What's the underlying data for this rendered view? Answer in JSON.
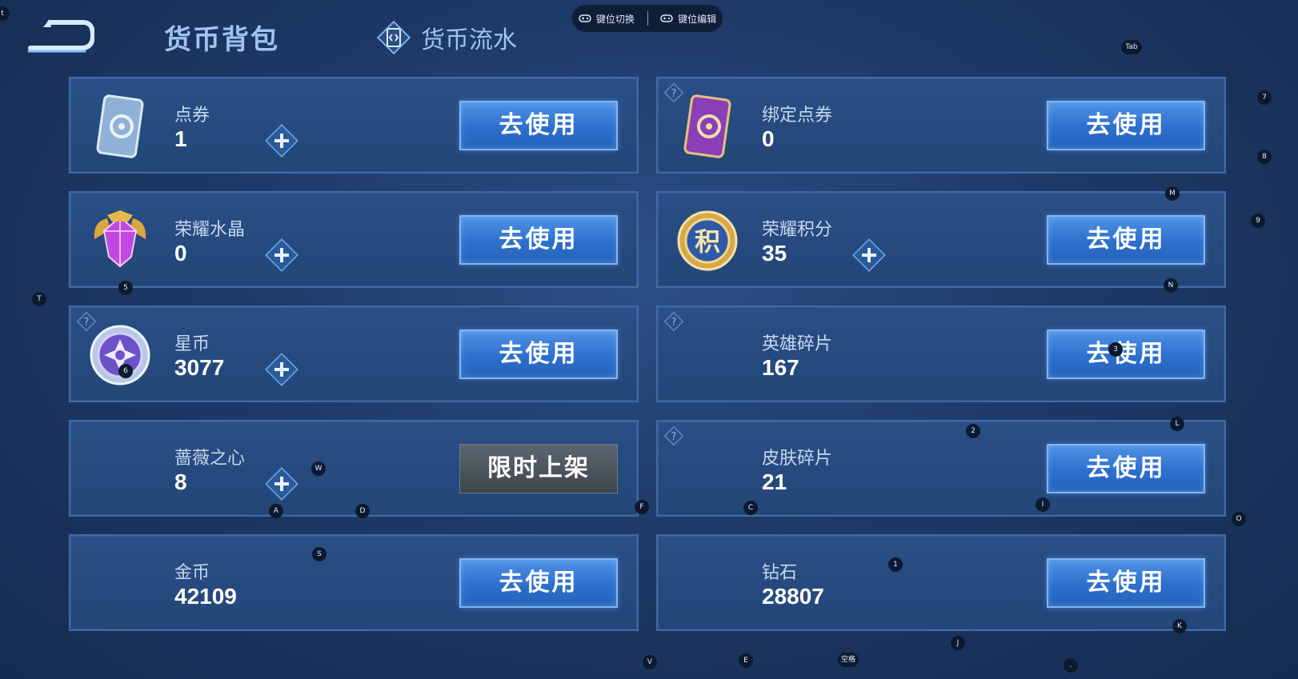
{
  "header": {
    "title": "货币背包",
    "flow_tab": "货币流水"
  },
  "keybar": {
    "switch_label": "键位切换",
    "edit_label": "键位编辑"
  },
  "currencies": [
    {
      "name": "点券",
      "value": "1",
      "action": "去使用",
      "icon": "ticket-icon"
    },
    {
      "name": "绑定点券",
      "value": "0",
      "action": "去使用",
      "icon": "bound-ticket-icon"
    },
    {
      "name": "荣耀水晶",
      "value": "0",
      "action": "去使用",
      "icon": "crystal-icon"
    },
    {
      "name": "荣耀积分",
      "value": "35",
      "action": "去使用",
      "icon": "points-coin-icon",
      "icon_text": "积"
    },
    {
      "name": "星币",
      "value": "3077",
      "action": "去使用",
      "icon": "star-coin-icon"
    },
    {
      "name": "英雄碎片",
      "value": "167",
      "action": "去使用",
      "icon": "none"
    },
    {
      "name": "蔷薇之心",
      "value": "8",
      "action": "限时上架",
      "icon": "none"
    },
    {
      "name": "皮肤碎片",
      "value": "21",
      "action": "去使用",
      "icon": "none"
    },
    {
      "name": "金币",
      "value": "42109",
      "action": "去使用",
      "icon": "none"
    },
    {
      "name": "钻石",
      "value": "28807",
      "action": "去使用",
      "icon": "none"
    }
  ],
  "key_hints": [
    "Tab",
    "7",
    "8",
    "M",
    "9",
    "5",
    "N",
    "T",
    "6",
    "3",
    "2",
    "L",
    "W",
    "A",
    "D",
    "F",
    "C",
    "I",
    "O",
    "S",
    "1",
    "K",
    "J",
    "V",
    "E",
    "空格",
    ".",
    "t"
  ],
  "colors": {
    "use_button": "#2d6fcc",
    "limited_button": "#4a525b",
    "card_bg": "#234677",
    "card_border": "#3e6aa6"
  }
}
